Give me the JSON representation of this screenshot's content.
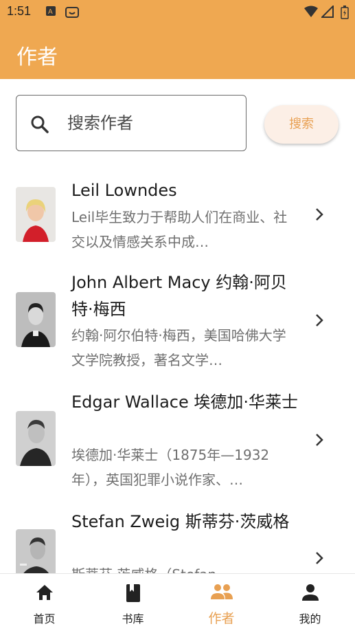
{
  "status_bar": {
    "time": "1:51"
  },
  "app_bar": {
    "title": "作者"
  },
  "search": {
    "placeholder": "搜索作者",
    "button_label": "搜索"
  },
  "authors": [
    {
      "name": "Leil Lowndes",
      "desc": "Leil毕生致力于帮助人们在商业、社交以及情感关系中成…"
    },
    {
      "name": "John Albert Macy 约翰·阿贝特·梅西",
      "desc": "约翰·阿尔伯特·梅西，美国哈佛大学文学院教授，著名文学…"
    },
    {
      "name": "Edgar Wallace 埃德加·华莱士",
      "desc": "埃德加·华莱士（1875年—1932年），英国犯罪小说作家、…"
    },
    {
      "name": "Stefan Zweig 斯蒂芬·茨威格",
      "desc": "斯蒂芬·茨威格（Stefan"
    }
  ],
  "bottom_nav": [
    {
      "label": "首页",
      "icon": "home-icon",
      "active": false
    },
    {
      "label": "书库",
      "icon": "book-icon",
      "active": false
    },
    {
      "label": "作者",
      "icon": "people-icon",
      "active": true
    },
    {
      "label": "我的",
      "icon": "person-icon",
      "active": false
    }
  ],
  "colors": {
    "accent": "#EFA851",
    "button_bg": "#FCEFE6",
    "active_nav": "#E8A052"
  }
}
